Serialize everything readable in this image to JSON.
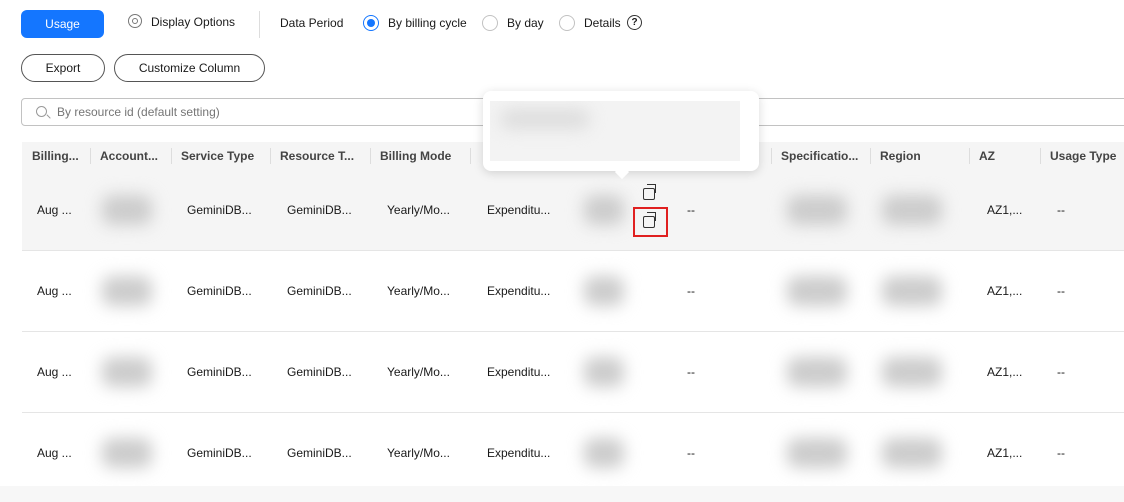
{
  "toolbar": {
    "usage": "Usage",
    "display_options": "Display Options",
    "data_period": "Data Period",
    "periods": [
      {
        "label": "By billing cycle",
        "selected": true
      },
      {
        "label": "By day",
        "selected": false
      },
      {
        "label": "Details",
        "selected": false
      }
    ],
    "help": "?",
    "export": "Export",
    "customize": "Customize Column"
  },
  "search": {
    "placeholder": "By resource id (default setting)"
  },
  "table": {
    "headers": [
      "Billing...",
      "Account...",
      "Service Type",
      "Resource T...",
      "Billing Mode",
      "Specificatio...",
      "Region",
      "AZ",
      "Usage Type"
    ],
    "rows": [
      {
        "billing": "Aug ...",
        "service": "GeminiDB...",
        "resource_type": "GeminiDB...",
        "mode": "Yearly/Mo...",
        "expenditure": "Expenditu...",
        "dash": "--",
        "az": "AZ1,...",
        "usage": "--"
      },
      {
        "billing": "Aug ...",
        "service": "GeminiDB...",
        "resource_type": "GeminiDB...",
        "mode": "Yearly/Mo...",
        "expenditure": "Expenditu...",
        "dash": "--",
        "az": "AZ1,...",
        "usage": "--"
      },
      {
        "billing": "Aug ...",
        "service": "GeminiDB...",
        "resource_type": "GeminiDB...",
        "mode": "Yearly/Mo...",
        "expenditure": "Expenditu...",
        "dash": "--",
        "az": "AZ1,...",
        "usage": "--"
      },
      {
        "billing": "Aug ...",
        "service": "GeminiDB...",
        "resource_type": "GeminiDB...",
        "mode": "Yearly/Mo...",
        "expenditure": "Expenditu...",
        "dash": "--",
        "az": "AZ1,...",
        "usage": "--"
      }
    ]
  },
  "colors": {
    "primary": "#1476ff",
    "highlight": "#e02020"
  }
}
